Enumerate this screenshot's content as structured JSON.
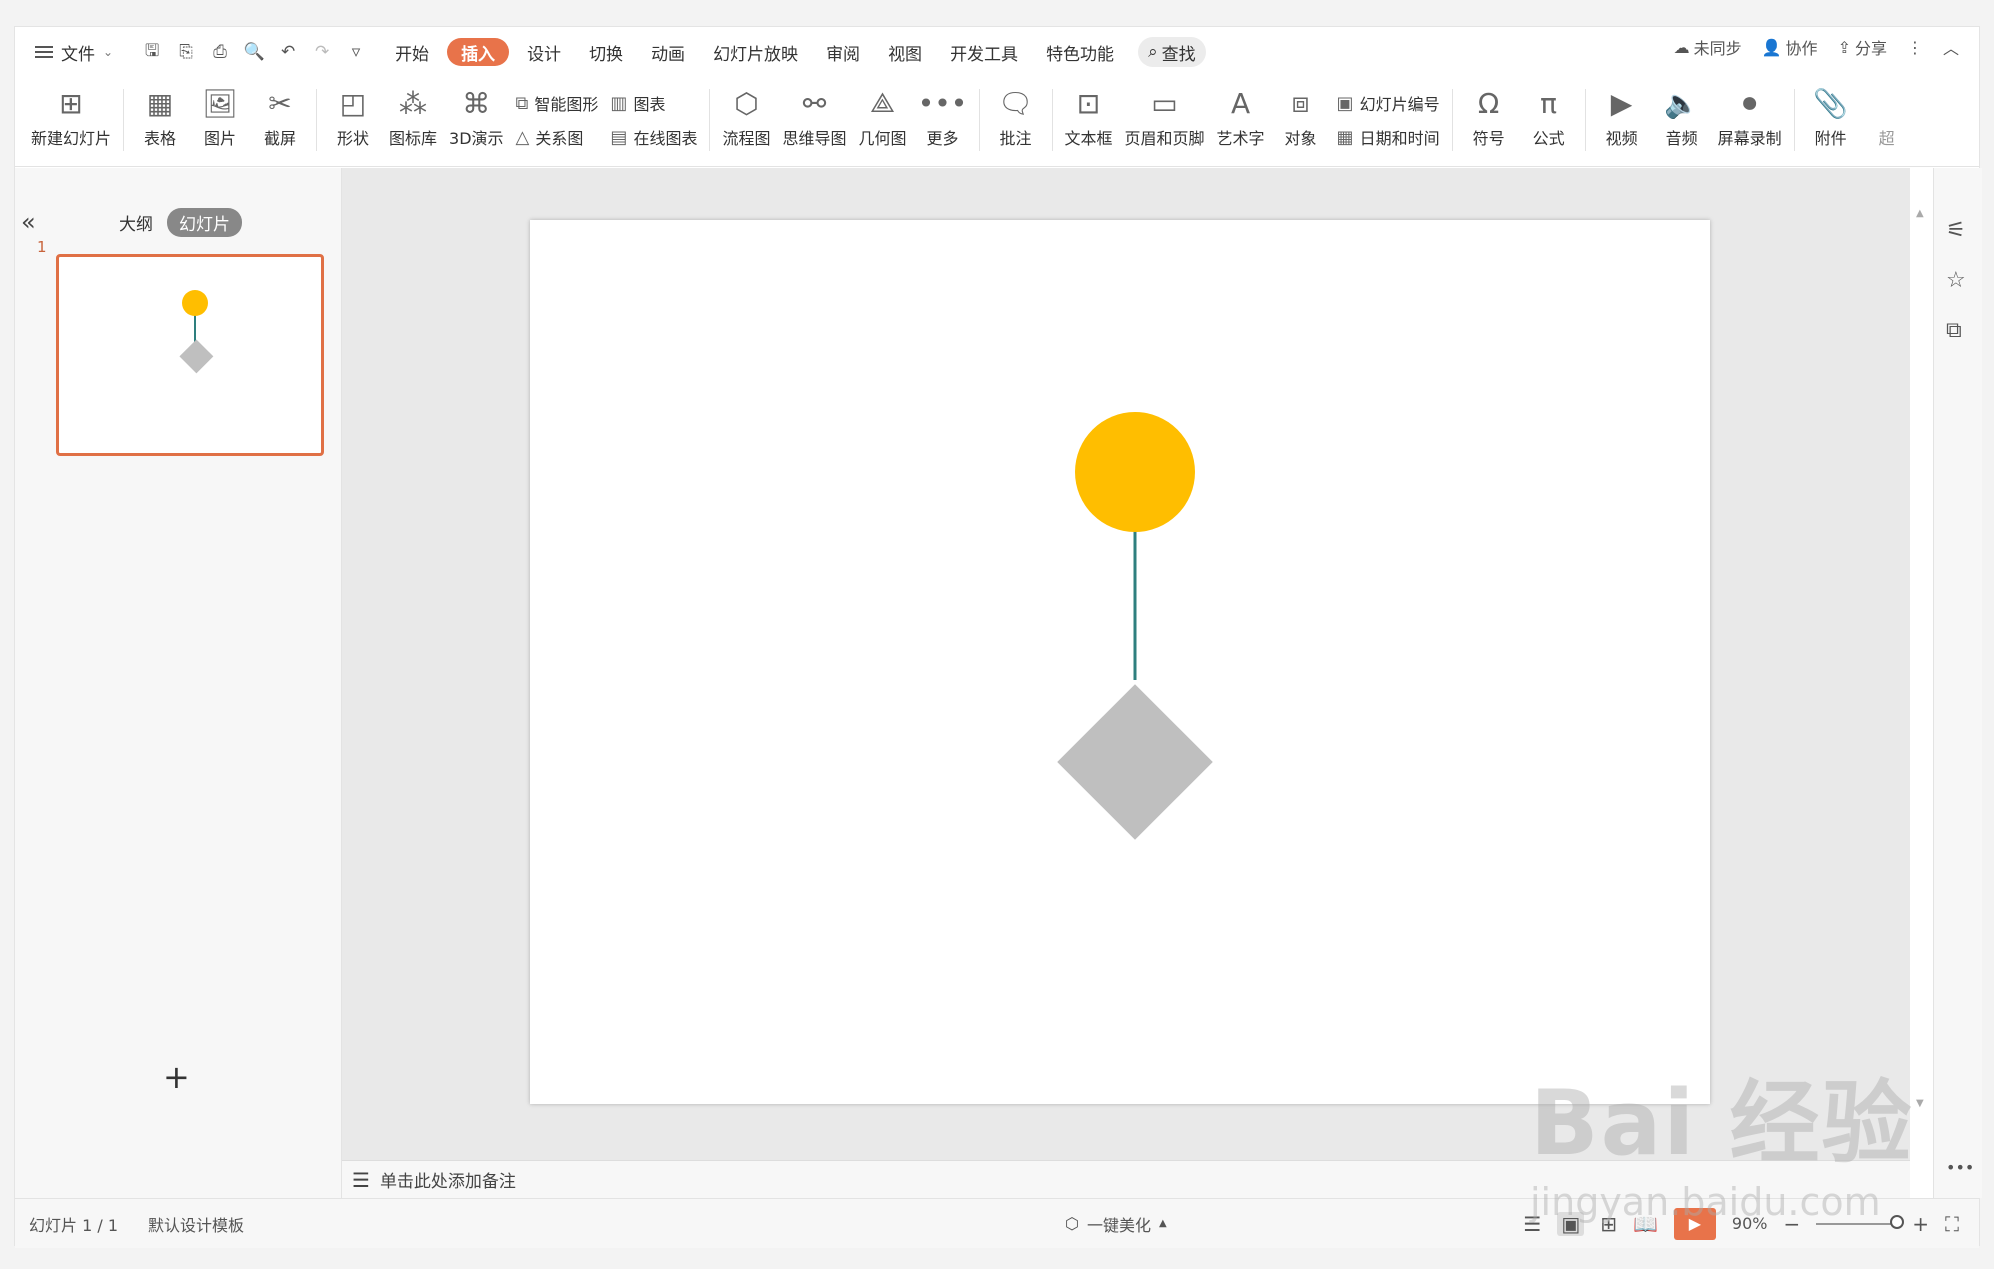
{
  "menubar": {
    "file_label": "文件",
    "tabs": [
      "开始",
      "插入",
      "设计",
      "切换",
      "动画",
      "幻灯片放映",
      "审阅",
      "视图",
      "开发工具",
      "特色功能"
    ],
    "active_tab": "插入",
    "search_label": "查找",
    "right": {
      "sync": "未同步",
      "collab": "协作",
      "share": "分享"
    }
  },
  "ribbon": {
    "new_slide": "新建幻灯片",
    "table": "表格",
    "picture": "图片",
    "screenshot": "截屏",
    "shape": "形状",
    "icon_lib": "图标库",
    "demo3d": "3D演示",
    "smart_art": "智能图形",
    "relation": "关系图",
    "chart": "图表",
    "online_chart": "在线图表",
    "flowchart": "流程图",
    "mindmap": "思维导图",
    "geometry": "几何图",
    "more": "更多",
    "comment": "批注",
    "textbox": "文本框",
    "header_footer": "页眉和页脚",
    "wordart": "艺术字",
    "object": "对象",
    "slide_number": "幻灯片编号",
    "date_time": "日期和时间",
    "symbol": "符号",
    "formula": "公式",
    "video": "视频",
    "audio": "音频",
    "screen_record": "屏幕录制",
    "attachment": "附件",
    "overflow": "超"
  },
  "leftpanel": {
    "outline_tab": "大纲",
    "slides_tab": "幻灯片",
    "slide_number": "1",
    "add_symbol": "+"
  },
  "slide": {
    "circle_color": "#FFBE00",
    "line_color": "#2E7F7E",
    "diamond_color": "#BFBFBF"
  },
  "notes": {
    "placeholder": "单击此处添加备注"
  },
  "statusbar": {
    "slide_count": "幻灯片 1 / 1",
    "template": "默认设计模板",
    "beautify": "一键美化",
    "zoom": "90%"
  },
  "watermark": {
    "brand": "Bai 经验",
    "url": "jingyan.baidu.com"
  }
}
